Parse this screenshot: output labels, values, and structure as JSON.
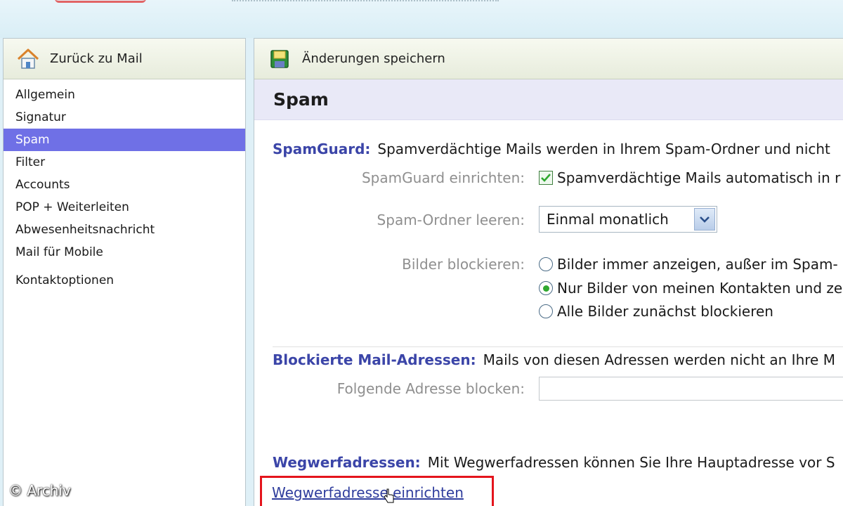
{
  "sidebar": {
    "back_label": "Zurück zu Mail",
    "items": [
      {
        "label": "Allgemein"
      },
      {
        "label": "Signatur"
      },
      {
        "label": "Spam"
      },
      {
        "label": "Filter"
      },
      {
        "label": "Accounts"
      },
      {
        "label": "POP + Weiterleiten"
      },
      {
        "label": "Abwesenheitsnachricht"
      },
      {
        "label": "Mail für Mobile"
      },
      {
        "label": "Kontaktoptionen"
      }
    ],
    "active_item": "Spam"
  },
  "toolbar": {
    "save_label": "Änderungen speichern"
  },
  "page": {
    "title": "Spam"
  },
  "spamguard": {
    "heading": "SpamGuard:",
    "description": "Spamverdächtige Mails werden in Ihrem Spam-Ordner und nicht",
    "setup_label": "SpamGuard einrichten:",
    "setup_checkbox_text": "Spamverdächtige Mails automatisch in r",
    "setup_checked": true,
    "empty_label": "Spam-Ordner leeren:",
    "empty_value": "Einmal monatlich",
    "images_label": "Bilder blockieren:",
    "image_options": [
      {
        "text": "Bilder immer anzeigen, außer im Spam-",
        "checked": false
      },
      {
        "text": "Nur Bilder von meinen Kontakten und ze",
        "checked": true
      },
      {
        "text": "Alle Bilder zunächst blockieren",
        "checked": false
      }
    ]
  },
  "blocked": {
    "heading": "Blockierte Mail-Adressen:",
    "description": "Mails von diesen Adressen werden nicht an Ihre M",
    "block_label": "Folgende Adresse blocken:",
    "block_value": ""
  },
  "disposable": {
    "heading": "Wegwerfadressen:",
    "description": "Mit Wegwerfadressen können Sie Ihre Hauptadresse vor S",
    "link_label": "Wegwerfadresse einrichten"
  },
  "watermark": "© Archiv",
  "colors": {
    "active_nav": "#6f70e6",
    "heading_blue": "#3b45a8",
    "highlight_red": "#e4141c",
    "check_green": "#2fa82f"
  }
}
